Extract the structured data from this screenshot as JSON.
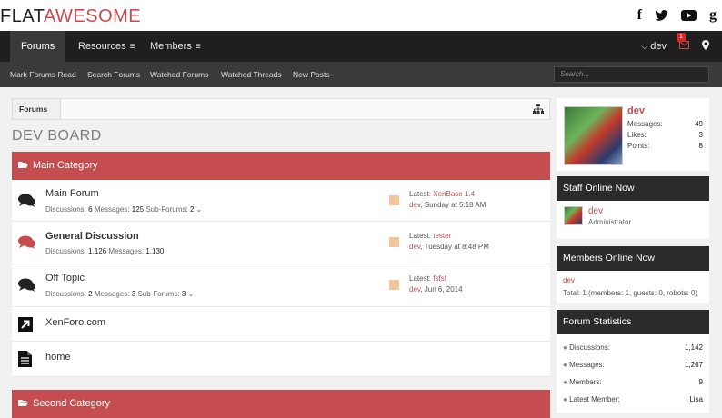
{
  "logo": {
    "part1": "FLAT",
    "part2": "AWESOME"
  },
  "social": {
    "facebook": "f",
    "twitter": "t",
    "youtube": "▶",
    "google": "g"
  },
  "nav": {
    "tabs": [
      {
        "label": "Forums"
      },
      {
        "label": "Resources"
      },
      {
        "label": "Members"
      }
    ],
    "burger": "≡",
    "user": "dev",
    "inbox_count": "1"
  },
  "subnav": {
    "links": [
      "Mark Forums Read",
      "Search Forums",
      "Watched Forums",
      "Watched Threads",
      "New Posts"
    ],
    "search_placeholder": "Search..."
  },
  "breadcrumb": {
    "item": "Forums"
  },
  "board_title": "DEV BOARD",
  "categories": [
    {
      "title": "Main Category"
    },
    {
      "title": "Second Category"
    }
  ],
  "nodes": [
    {
      "title": "Main Forum",
      "discussions_label": "Discussions:",
      "discussions": "6",
      "messages_label": "Messages:",
      "messages": "125",
      "subforums_label": "Sub-Forums:",
      "subforums": "2",
      "latest_label": "Latest:",
      "latest_thread": "XenBase 1.4",
      "latest_user": "dev",
      "latest_time": ", Sunday at 5:18 AM"
    },
    {
      "title": "General Discussion",
      "discussions_label": "Discussions:",
      "discussions": "1,126",
      "messages_label": "Messages:",
      "messages": "1,130",
      "latest_label": "Latest:",
      "latest_thread": "tester",
      "latest_user": "dev",
      "latest_time": ", Tuesday at 8:48 PM"
    },
    {
      "title": "Off Topic",
      "discussions_label": "Discussions:",
      "discussions": "2",
      "messages_label": "Messages:",
      "messages": "3",
      "subforums_label": "Sub-Forums:",
      "subforums": "3",
      "latest_label": "Latest:",
      "latest_thread": "fsfsf",
      "latest_user": "dev",
      "latest_time": ", Jun 6, 2014"
    },
    {
      "title": "XenForo.com"
    },
    {
      "title": "home"
    }
  ],
  "profile": {
    "name": "dev",
    "messages_label": "Messages:",
    "messages": "49",
    "likes_label": "Likes:",
    "likes": "3",
    "points_label": "Points:",
    "points": "8"
  },
  "staff_online": {
    "heading": "Staff Online Now",
    "name": "dev",
    "role": "Administrator"
  },
  "members_online": {
    "heading": "Members Online Now",
    "name": "dev",
    "total": "Total: 1 (members: 1, guests: 0, robots: 0)"
  },
  "forum_stats": {
    "heading": "Forum Statistics",
    "rows": [
      {
        "label": "Discussions:",
        "value": "1,142"
      },
      {
        "label": "Messages:",
        "value": "1,267"
      },
      {
        "label": "Members:",
        "value": "9"
      },
      {
        "label": "Latest Member:",
        "value": "Lisa"
      }
    ]
  },
  "colors": {
    "accent": "#c64d4f",
    "nav": "#1f1f1f",
    "subnav": "#3a3a3a"
  }
}
